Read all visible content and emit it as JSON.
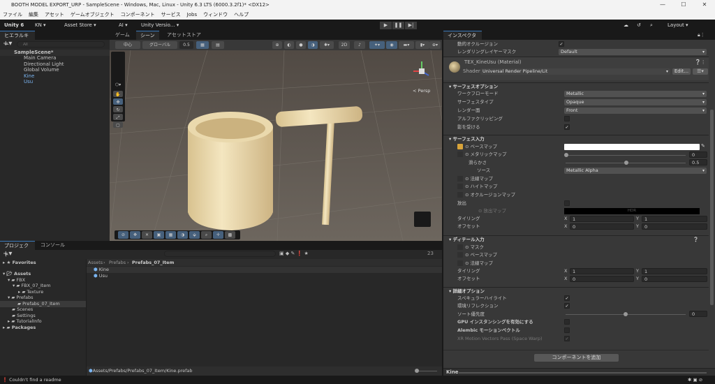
{
  "window": {
    "title": "BOOTH MODEL EXPORT_URP - SampleScene - Windows, Mac, Linux - Unity 6.3 LTS (6000.3.2f1)* <DX12>",
    "min": "—",
    "max": "☐",
    "close": "✕"
  },
  "menu": [
    "ファイル",
    "編集",
    "アセット",
    "ゲームオブジェクト",
    "コンポーネント",
    "サービス",
    "Jobs",
    "ウィンドウ",
    "ヘルプ"
  ],
  "toolbar": {
    "unity": "Unity 6",
    "account": "KN ▾",
    "asset_store": "Asset Store ▾",
    "ai": "AI ▾",
    "version": "Unity Versio... ▾",
    "layout": "Layout ▾",
    "play": "▶",
    "pause": "❚❚",
    "step": "▶|"
  },
  "hierarchy": {
    "tab": "ヒエラルキー",
    "search_placeholder": "All",
    "scene": "SampleScene*",
    "items": [
      {
        "label": "Main Camera"
      },
      {
        "label": "Directional Light"
      },
      {
        "label": "Global Volume"
      },
      {
        "label": "Kine"
      },
      {
        "label": "Usu"
      }
    ]
  },
  "scene": {
    "tabs": [
      "ゲーム",
      "シーン",
      "アセットストア"
    ],
    "pivot": "中心",
    "space": "グローバル",
    "snap": "0.5",
    "persp": "< Persp"
  },
  "inspector": {
    "tab": "インスペクター",
    "dynamic_occlusion": "動的オクルージョン",
    "render_layer": "レンダリングレイヤーマスク",
    "render_layer_value": "Default",
    "material_name": "TEX_KineUsu (Material)",
    "shader_label": "Shader",
    "shader_value": "Universal Render Pipeline/Lit",
    "edit": "Edit...",
    "surface_options": "サーフェスオプション",
    "workflow": "ワークフローモード",
    "workflow_value": "Metallic",
    "surface_type": "サーフェスタイプ",
    "surface_type_value": "Opaque",
    "render_face": "レンダー面",
    "render_face_value": "Front",
    "alpha_clip": "アルファクリッピング",
    "receive_shadows": "影を受ける",
    "surface_inputs": "サーフェス入力",
    "base_map": "ベースマップ",
    "metallic_map": "メタリックマップ",
    "metallic_value": "0",
    "smoothness": "滑らかさ",
    "smoothness_value": "0.5",
    "smoothness_fraction": 0.5,
    "source": "ソース",
    "source_value": "Metallic Alpha",
    "normal_map": "法線マップ",
    "height_map": "ハイトマップ",
    "occlusion_map": "オクルージョンマップ",
    "emission": "放出",
    "emission_map": "放出マップ",
    "hdr": "HDR",
    "tiling": "タイリング",
    "offset": "オフセット",
    "x": "X",
    "y": "Y",
    "tiling_x": "1",
    "tiling_y": "1",
    "offset_x": "0",
    "offset_y": "0",
    "detail_inputs": "ディテール入力",
    "mask": "マスク",
    "detail_base": "ベースマップ",
    "detail_normal": "法線マップ",
    "d_tiling_x": "1",
    "d_tiling_y": "1",
    "d_offset_x": "0",
    "d_offset_y": "0",
    "advanced": "詳細オプション",
    "specular": "スペキュラーハイライト",
    "env_reflect": "環境リフレクション",
    "sort_priority": "ソート優先度",
    "sort_value": "0",
    "gpu_instancing": "GPU インスタンシングを有効にする",
    "alembic": "Alembic モーションベクトル",
    "xr_motion": "XR Motion Vectors Pass (Space Warp)",
    "add_component": "コンポーネントを追加",
    "footer": "Kine"
  },
  "project": {
    "tabs": [
      "プロジェクト",
      "コンソール"
    ],
    "favorites": "Favorites",
    "tree": [
      "Assets",
      "FBX",
      "FBX_07_Item",
      "Texture",
      "Prefabs",
      "Prefabs_07_Item",
      "Scenes",
      "Settings",
      "TutorialInfo",
      "Packages"
    ],
    "breadcrumb": [
      "Assets",
      "Prefabs",
      "Prefabs_07_Item"
    ],
    "files": [
      "Kine",
      "Usu"
    ],
    "count": "23",
    "path": "Assets/Prefabs/Prefabs_07_Item/Kine.prefab"
  },
  "status": {
    "message": "Couldn't find a readme"
  },
  "colors": {
    "accent": "#3a79bb",
    "wood": "#e8d6a8",
    "floor": "#6f6961"
  }
}
